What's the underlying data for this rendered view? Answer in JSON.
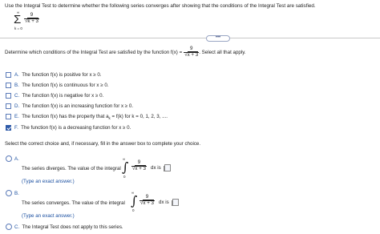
{
  "question": {
    "prompt": "Use the Integral Test to determine whether the following series converges after showing that the conditions of the Integral Test are satisfied.",
    "sum_upper": "∞",
    "sum_lower": "k = 0",
    "num": "9",
    "den": "k + 3"
  },
  "more_button": "•••",
  "part1": {
    "prompt_before": "Determine which conditions of the Integral Test are satisfied by the function f(x) =",
    "num": "9",
    "den": "x + 3",
    "prompt_after": ". Select all that apply."
  },
  "conditions": [
    {
      "letter": "A.",
      "text": "The function f(x) is positive for x ≥ 0.",
      "checked": false
    },
    {
      "letter": "B.",
      "text": "The function f(x) is continuous for x ≥ 0.",
      "checked": false
    },
    {
      "letter": "C.",
      "text": "The function f(x) is negative for x ≥ 0.",
      "checked": false
    },
    {
      "letter": "D.",
      "text": "The function f(x) is an increasing function for x ≥ 0.",
      "checked": false
    },
    {
      "letter": "E.",
      "text": "The function f(x) has the property that a",
      "sub": "k",
      "text_after": " = f(k) for k = 0, 1, 2, 3, ....",
      "checked": false
    },
    {
      "letter": "F.",
      "text": "The function f(x) is a decreasing function for x ≥ 0.",
      "checked": true
    }
  ],
  "part2": {
    "prompt": "Select the correct choice and, if necessary, fill in the answer box to complete your choice."
  },
  "choice_a": {
    "letter": "A.",
    "text": "The series diverges. The value of the integral",
    "upper": "∞",
    "lower": "0",
    "num": "9",
    "den": "x + 3",
    "dx": "dx is",
    "hint": "(Type an exact answer.)"
  },
  "choice_b": {
    "letter": "B.",
    "text": "The series converges. The value of the integral",
    "upper": "∞",
    "lower": "0",
    "num": "9",
    "den": "x + 3",
    "dx": "dx is",
    "hint": "(Type an exact answer.)"
  },
  "choice_c": {
    "letter": "C.",
    "text": "The Integral Test does not apply to this series."
  },
  "colors": {
    "accent": "#1a4fa0",
    "checkbox": "#2e5aa8"
  }
}
